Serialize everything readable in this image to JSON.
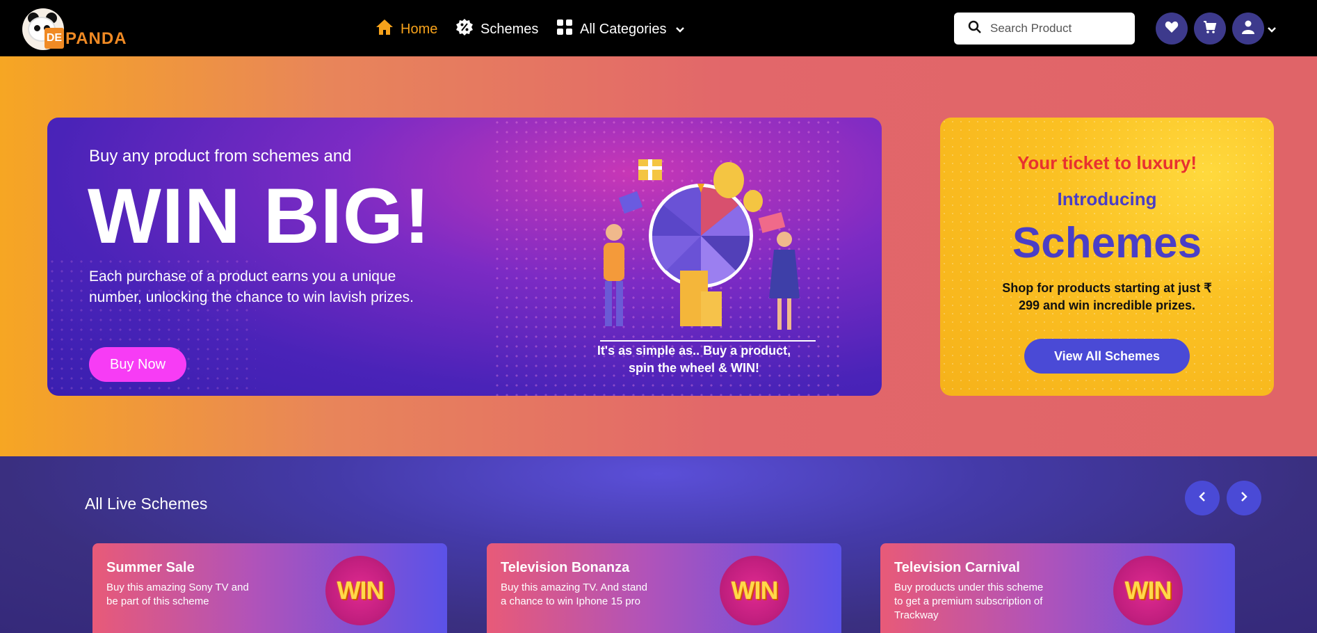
{
  "header": {
    "logo_text": "PANDA",
    "logo_bag_text": "DE",
    "nav": [
      {
        "label": "Home",
        "icon": "home-icon",
        "active": true
      },
      {
        "label": "Schemes",
        "icon": "percent-badge-icon"
      },
      {
        "label": "All Categories",
        "icon": "grid-icon"
      }
    ],
    "search_placeholder": "Search Product"
  },
  "hero": {
    "banner": {
      "subtitle": "Buy any product from schemes and",
      "headline": "WIN BIG!",
      "description": "Each purchase of a product earns you a unique number, unlocking the chance to win lavish prizes.",
      "button_label": "Buy Now",
      "caption": "It's as simple as.. Buy a product, spin the wheel & WIN!"
    },
    "card": {
      "tagline": "Your ticket to luxury!",
      "intro": "Introducing",
      "title": "Schemes",
      "description": "Shop for products starting at just ₹ 299 and win incredible prizes.",
      "button_label": "View All Schemes"
    }
  },
  "schemes": {
    "title": "All Live Schemes",
    "items": [
      {
        "name": "Summer Sale",
        "description": "Buy this amazing Sony TV and be part of this scheme",
        "badge": "WIN"
      },
      {
        "name": "Television Bonanza",
        "description": "Buy this amazing TV. And stand a chance to win Iphone 15 pro",
        "badge": "WIN"
      },
      {
        "name": "Television Carnival",
        "description": "Buy products under this scheme to get a premium subscription of Trackway",
        "badge": "WIN"
      }
    ]
  },
  "colors": {
    "accent": "#f6a21b",
    "primary": "#4a4ad6",
    "buy_button": "#f73cf5",
    "ticket_red": "#e8312f"
  }
}
